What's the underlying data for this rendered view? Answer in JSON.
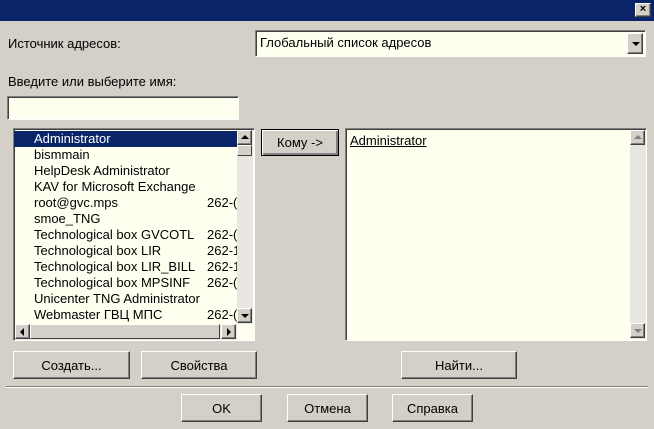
{
  "window": {
    "close_glyph": "×"
  },
  "source": {
    "label": "Источник адресов:",
    "value": "Глобальный список адресов"
  },
  "name_entry": {
    "label": "Введите или выберите имя:",
    "value": "",
    "placeholder": ""
  },
  "address_list": {
    "items": [
      {
        "name": "Administrator",
        "phone": "",
        "selected": true
      },
      {
        "name": "bismmain",
        "phone": ""
      },
      {
        "name": "HelpDesk Administrator",
        "phone": ""
      },
      {
        "name": "KAV for Microsoft Exchange",
        "phone": ""
      },
      {
        "name": "root@gvc.mps",
        "phone": "262-("
      },
      {
        "name": "smoe_TNG",
        "phone": ""
      },
      {
        "name": "Technological box GVCOTL",
        "phone": "262-("
      },
      {
        "name": "Technological box LIR",
        "phone": "262-1"
      },
      {
        "name": "Technological box LIR_BILL",
        "phone": "262-1"
      },
      {
        "name": "Technological box MPSINF",
        "phone": "262-("
      },
      {
        "name": "Unicenter TNG Administrator",
        "phone": ""
      },
      {
        "name": "Webmaster ГВЦ МПС",
        "phone": "262-("
      }
    ]
  },
  "to_button": {
    "label": "Кому ->"
  },
  "recipients": {
    "items": [
      "Administrator"
    ]
  },
  "buttons": {
    "create": "Создать...",
    "properties": "Свойства",
    "find": "Найти...",
    "ok": "OK",
    "cancel": "Отмена",
    "help": "Справка"
  },
  "colors": {
    "titlebar": "#0a246a",
    "selection": "#0a246a",
    "face": "#d4d0c8",
    "field": "#fffff0"
  }
}
